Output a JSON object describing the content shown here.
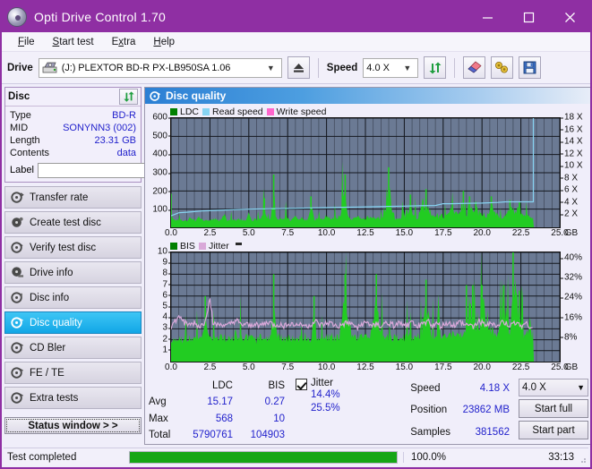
{
  "window": {
    "title": "Opti Drive Control 1.70",
    "logo_icon": "disc-logo-icon",
    "minimize": "minimize-icon",
    "maximize": "maximize-icon",
    "close": "close-icon"
  },
  "menu": [
    {
      "label": "File"
    },
    {
      "label": "Start test"
    },
    {
      "label": "Extra"
    },
    {
      "label": "Help"
    }
  ],
  "toolbar": {
    "drive_label": "Drive",
    "drive_value": "(J:)  PLEXTOR BD-R  PX-LB950SA 1.06",
    "eject_icon": "eject-icon",
    "speed_label": "Speed",
    "speed_value": "4.0 X",
    "refresh_icon": "refresh-icon",
    "erase_icon": "eraser-icon",
    "tools_icon": "wrench-icon",
    "save_icon": "floppy-save-icon"
  },
  "disc_panel": {
    "title": "Disc",
    "refresh_icon": "refresh-icon",
    "rows": [
      {
        "key": "Type",
        "value": "BD-R"
      },
      {
        "key": "MID",
        "value": "SONYNN3 (002)"
      },
      {
        "key": "Length",
        "value": "23.31 GB"
      },
      {
        "key": "Contents",
        "value": "data"
      }
    ],
    "label_key": "Label",
    "label_value": "",
    "label_placeholder": "",
    "label_icon": "disc-icon"
  },
  "nav": [
    {
      "label": "Transfer rate",
      "icon": "disc-transfer-icon",
      "active": false
    },
    {
      "label": "Create test disc",
      "icon": "disc-create-icon",
      "active": false
    },
    {
      "label": "Verify test disc",
      "icon": "disc-verify-icon",
      "active": false
    },
    {
      "label": "Drive info",
      "icon": "disc-drive-icon",
      "active": false
    },
    {
      "label": "Disc info",
      "icon": "disc-info-icon",
      "active": false
    },
    {
      "label": "Disc quality",
      "icon": "disc-quality-icon",
      "active": true
    },
    {
      "label": "CD Bler",
      "icon": "disc-bler-icon",
      "active": false
    },
    {
      "label": "FE / TE",
      "icon": "disc-fete-icon",
      "active": false
    },
    {
      "label": "Extra tests",
      "icon": "disc-extra-icon",
      "active": false
    }
  ],
  "status_window_button": "Status window > >",
  "panel": {
    "title": "Disc quality",
    "title_icon": "disc-quality-icon"
  },
  "stats": {
    "headers": [
      "",
      "LDC",
      "BIS"
    ],
    "rows": [
      {
        "label": "Avg",
        "ldc": "15.17",
        "bis": "0.27"
      },
      {
        "label": "Max",
        "ldc": "568",
        "bis": "10"
      },
      {
        "label": "Total",
        "ldc": "5790761",
        "bis": "104903"
      }
    ],
    "jitter_label": "Jitter",
    "jitter_checked": true,
    "jitter_avg": "14.4%",
    "jitter_max": "25.5%",
    "speed_label": "Speed",
    "speed_value": "4.18 X",
    "position_label": "Position",
    "position_value": "23862 MB",
    "samples_label": "Samples",
    "samples_value": "381562",
    "speed_select": "4.0 X",
    "start_full": "Start full",
    "start_part": "Start part"
  },
  "statusbar": {
    "message": "Test completed",
    "progress_percent": 100.0,
    "progress_text": "100.0%",
    "elapsed": "33:13"
  },
  "colors": {
    "accent": "#8f2fa3",
    "ldc_green": "#00a800",
    "bis_green": "#00a800",
    "read_speed": "#87d4f2",
    "write_speed": "#ff66cc",
    "jitter": "#d9a8d9",
    "plot_bg": "#6b7a94",
    "value_blue": "#2222cc",
    "progress_green": "#16a616"
  },
  "chart_data": [
    {
      "type": "area",
      "name": "ldc-chart",
      "title": "",
      "xlabel": "GB",
      "ylabel": "LDC",
      "xlim": [
        0,
        25
      ],
      "ylim": [
        0,
        600
      ],
      "xticks": [
        0.0,
        2.5,
        5.0,
        7.5,
        10.0,
        12.5,
        15.0,
        17.5,
        20.0,
        22.5,
        25.0
      ],
      "xticklabels": [
        "0.0",
        "2.5",
        "5.0",
        "7.5",
        "10.0",
        "12.5",
        "15.0",
        "17.5",
        "20.0",
        "22.5",
        "25.0"
      ],
      "yticks": [
        100,
        200,
        300,
        400,
        500,
        600
      ],
      "yticklabels": [
        "100",
        "200",
        "300",
        "400",
        "500",
        "600"
      ],
      "right_axis_label": "X",
      "right_ylim": [
        0,
        18
      ],
      "right_yticks": [
        2,
        4,
        6,
        8,
        10,
        12,
        14,
        16,
        18
      ],
      "right_yticklabels": [
        "2 X",
        "4 X",
        "6 X",
        "8 X",
        "10 X",
        "12 X",
        "14 X",
        "16 X",
        "18 X"
      ],
      "grid": true,
      "legend": [
        {
          "name": "LDC",
          "color": "#008000"
        },
        {
          "name": "Read speed",
          "color": "#87d4f2"
        },
        {
          "name": "Write speed",
          "color": "#ff66cc"
        }
      ],
      "series": [
        {
          "name": "LDC",
          "type": "area",
          "color": "#00cc00",
          "x": [
            0.0,
            0.1,
            0.2,
            0.3,
            0.4,
            0.5,
            0.6,
            0.7,
            0.8,
            0.9,
            1.0,
            1.2,
            1.4,
            1.6,
            1.8,
            2.0,
            2.2,
            2.4,
            2.6,
            2.8,
            3.0,
            3.2,
            3.4,
            3.6,
            3.8,
            4.0,
            4.2,
            4.4,
            4.6,
            4.8,
            5.0,
            5.2,
            5.4,
            5.6,
            5.8,
            6.0,
            6.2,
            6.4,
            6.6,
            6.8,
            7.0,
            7.2,
            7.4,
            7.6,
            7.8,
            8.0,
            8.2,
            8.4,
            8.6,
            8.8,
            9.0,
            9.2,
            9.4,
            9.6,
            9.8,
            10.0,
            10.4,
            10.8,
            11.2,
            11.4,
            11.6,
            12.0,
            12.4,
            12.8,
            13.2,
            13.6,
            14.0,
            14.4,
            14.8,
            15.0,
            15.4,
            15.8,
            16.2,
            16.4,
            16.8,
            17.2,
            17.6,
            18.0,
            18.4,
            18.8,
            19.0,
            19.2,
            19.6,
            20.0,
            20.2,
            20.6,
            21.0,
            21.4,
            21.8,
            22.0,
            22.4,
            22.6,
            23.0,
            23.2,
            23.3
          ],
          "y": [
            185,
            60,
            35,
            30,
            40,
            30,
            25,
            30,
            35,
            28,
            30,
            60,
            35,
            30,
            70,
            30,
            40,
            30,
            28,
            60,
            30,
            35,
            90,
            30,
            40,
            35,
            30,
            60,
            40,
            30,
            110,
            35,
            40,
            30,
            45,
            160,
            40,
            30,
            290,
            40,
            50,
            40,
            75,
            35,
            40,
            55,
            40,
            60,
            35,
            45,
            170,
            40,
            50,
            35,
            45,
            80,
            50,
            45,
            290,
            60,
            50,
            60,
            45,
            70,
            50,
            60,
            330,
            55,
            60,
            70,
            180,
            60,
            150,
            210,
            90,
            80,
            70,
            110,
            90,
            200,
            80,
            170,
            140,
            120,
            70,
            170,
            80,
            60,
            150,
            110,
            140,
            90,
            70,
            60,
            0
          ]
        },
        {
          "name": "Read speed",
          "type": "line",
          "color": "#87d4f2",
          "axis": "right",
          "x": [
            0.0,
            0.5,
            1.0,
            1.5,
            2.0,
            3.0,
            4.0,
            5.0,
            6.0,
            7.0,
            8.0,
            9.0,
            10.0,
            11.0,
            12.0,
            13.0,
            14.0,
            15.0,
            16.0,
            17.0,
            17.5,
            18.0,
            19.0,
            20.0,
            21.0,
            21.5,
            22.0,
            23.0,
            23.3,
            23.3
          ],
          "y": [
            1.9,
            2.4,
            2.5,
            2.6,
            2.7,
            2.8,
            2.9,
            3.0,
            3.05,
            3.1,
            3.15,
            3.2,
            3.25,
            3.3,
            3.35,
            3.4,
            3.45,
            3.5,
            3.55,
            3.6,
            3.9,
            3.9,
            3.95,
            4.0,
            4.1,
            4.2,
            4.2,
            4.2,
            4.2,
            18.0
          ]
        }
      ]
    },
    {
      "type": "area",
      "name": "bis-chart",
      "title": "",
      "xlabel": "GB",
      "ylabel": "BIS",
      "xlim": [
        0,
        25
      ],
      "ylim": [
        0,
        10
      ],
      "xticks": [
        0.0,
        2.5,
        5.0,
        7.5,
        10.0,
        12.5,
        15.0,
        17.5,
        20.0,
        22.5,
        25.0
      ],
      "xticklabels": [
        "0.0",
        "2.5",
        "5.0",
        "7.5",
        "10.0",
        "12.5",
        "15.0",
        "17.5",
        "20.0",
        "22.5",
        "25.0"
      ],
      "yticks": [
        1,
        2,
        3,
        4,
        5,
        6,
        7,
        8,
        9,
        10
      ],
      "yticklabels": [
        "1",
        "2",
        "3",
        "4",
        "5",
        "6",
        "7",
        "8",
        "9",
        "10"
      ],
      "right_axis_label": "%",
      "right_ylim": [
        0,
        44
      ],
      "right_yticks": [
        8,
        16,
        24,
        32,
        40
      ],
      "right_yticklabels": [
        "8%",
        "16%",
        "24%",
        "32%",
        "40%"
      ],
      "grid": true,
      "legend": [
        {
          "name": "BIS",
          "color": "#008000"
        },
        {
          "name": "Jitter",
          "color": "#d9a8d9"
        }
      ],
      "series": [
        {
          "name": "BIS",
          "type": "area",
          "color": "#00cc00",
          "x": [
            0.0,
            0.2,
            0.4,
            0.6,
            0.8,
            1.0,
            1.2,
            1.4,
            1.6,
            1.8,
            2.0,
            2.2,
            2.4,
            2.6,
            2.8,
            3.0,
            3.2,
            3.4,
            3.6,
            3.8,
            4.0,
            4.2,
            4.4,
            4.6,
            4.8,
            5.0,
            5.2,
            5.4,
            5.6,
            5.8,
            6.0,
            6.2,
            6.4,
            6.6,
            6.8,
            7.0,
            7.2,
            7.4,
            7.6,
            7.8,
            8.0,
            8.2,
            8.4,
            8.6,
            8.8,
            9.0,
            9.2,
            9.4,
            9.6,
            9.8,
            10.0,
            10.4,
            10.8,
            11.2,
            11.6,
            12.0,
            12.4,
            12.8,
            13.2,
            13.6,
            14.0,
            14.4,
            14.8,
            15.2,
            15.6,
            16.0,
            16.4,
            16.8,
            17.2,
            17.6,
            18.0,
            18.4,
            18.8,
            19.0,
            19.4,
            19.8,
            20.0,
            20.4,
            20.8,
            21.0,
            21.4,
            21.8,
            22.0,
            22.4,
            22.6,
            23.0,
            23.2,
            23.3
          ],
          "y": [
            2.0,
            1.5,
            2.0,
            1.2,
            2.0,
            1.6,
            2.0,
            1.3,
            2.0,
            1.8,
            2.0,
            6.0,
            2.0,
            1.5,
            2.0,
            1.7,
            2.0,
            1.2,
            2.0,
            1.8,
            2.0,
            3.0,
            2.0,
            1.6,
            2.0,
            1.9,
            2.0,
            1.4,
            2.0,
            2.0,
            2.0,
            1.7,
            2.0,
            8.0,
            2.0,
            1.9,
            2.0,
            1.5,
            2.0,
            2.0,
            2.0,
            1.8,
            2.0,
            1.6,
            2.0,
            2.0,
            6.0,
            2.0,
            1.8,
            2.0,
            2.0,
            2.0,
            2.0,
            8.0,
            2.0,
            2.0,
            2.0,
            2.0,
            8.0,
            2.0,
            2.0,
            2.0,
            2.0,
            2.0,
            2.0,
            2.0,
            7.5,
            2.0,
            2.0,
            2.5,
            2.5,
            2.5,
            2.5,
            7.0,
            7.0,
            2.5,
            7.0,
            3.0,
            2.5,
            3.0,
            7.0,
            3.0,
            10.0,
            6.5,
            3.0,
            2.5,
            2.5,
            0
          ]
        },
        {
          "name": "Jitter",
          "type": "line",
          "color": "#d9a8d9",
          "axis": "right",
          "x": [
            0.0,
            0.3,
            0.6,
            0.9,
            1.2,
            1.5,
            1.8,
            2.1,
            2.4,
            2.5,
            2.7,
            3.0,
            3.3,
            3.6,
            3.9,
            4.2,
            4.5,
            4.8,
            5.1,
            5.4,
            5.7,
            6.0,
            6.3,
            6.6,
            6.9,
            7.2,
            7.5,
            7.8,
            8.1,
            8.4,
            8.7,
            9.0,
            9.3,
            9.6,
            9.9,
            10.2,
            10.5,
            10.8,
            11.1,
            11.4,
            11.7,
            12.0,
            12.3,
            12.6,
            12.9,
            13.2,
            13.5,
            13.8,
            14.1,
            14.4,
            14.7,
            15.0,
            15.3,
            15.6,
            15.9,
            16.2,
            16.5,
            16.8,
            17.1,
            17.4,
            17.7,
            18.0,
            18.3,
            18.6,
            18.9,
            19.2,
            19.5,
            19.8,
            20.1,
            20.4,
            20.7,
            21.0,
            21.3,
            21.6,
            21.9,
            22.2,
            22.5,
            22.8,
            23.2
          ],
          "y": [
            14.0,
            16.5,
            18.0,
            15.5,
            14.5,
            15.5,
            14.0,
            15.0,
            22.0,
            25.5,
            15.5,
            14.5,
            15.0,
            14.0,
            15.5,
            16.5,
            14.5,
            15.0,
            14.0,
            15.5,
            14.5,
            15.0,
            16.0,
            14.5,
            15.0,
            14.0,
            15.5,
            15.0,
            14.5,
            15.5,
            14.0,
            15.0,
            16.0,
            14.5,
            15.0,
            15.5,
            14.5,
            14.0,
            15.0,
            15.5,
            14.5,
            14.0,
            15.0,
            15.5,
            14.5,
            15.0,
            14.0,
            15.5,
            15.0,
            14.5,
            15.5,
            14.0,
            15.0,
            15.5,
            14.5,
            15.0,
            16.5,
            14.5,
            15.0,
            14.0,
            15.5,
            15.0,
            14.5,
            16.0,
            14.5,
            15.0,
            14.0,
            16.5,
            15.0,
            14.5,
            15.5,
            14.0,
            16.0,
            15.0,
            14.5,
            16.0,
            14.5,
            15.5,
            14.0
          ]
        }
      ]
    }
  ]
}
